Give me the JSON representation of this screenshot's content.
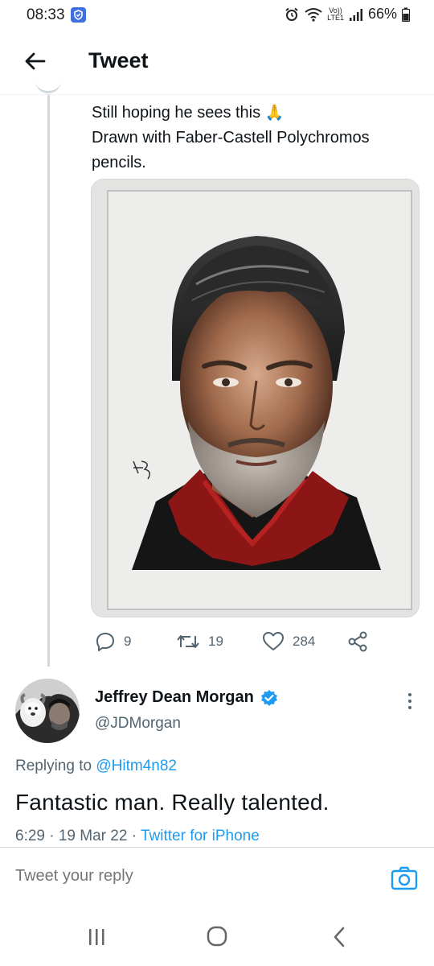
{
  "status_bar": {
    "time": "08:33",
    "volte_top": "Vo))",
    "volte_bottom": "LTE1",
    "battery": "66%"
  },
  "header": {
    "title": "Tweet"
  },
  "tweet": {
    "text_line1": "Still hoping he sees this",
    "emoji": "🙏",
    "text_line2": "Drawn with Faber-Castell Polychromos",
    "text_line3": "pencils.",
    "media_icon": "portrait-drawing-image",
    "actions": {
      "replies": "9",
      "retweets": "19",
      "likes": "284"
    }
  },
  "reply": {
    "name": "Jeffrey Dean Morgan",
    "handle": "@JDMorgan",
    "replying_label": "Replying to",
    "replying_to": "@Hitm4n82",
    "body": "Fantastic man. Really talented.",
    "time": "6:29 · 19 Mar 22 ·",
    "source": "Twitter for iPhone"
  },
  "composer": {
    "placeholder": "Tweet your reply"
  },
  "colors": {
    "accent": "#1d9bf0",
    "secondary_text": "#536471",
    "verified": "#1d9bf0"
  }
}
